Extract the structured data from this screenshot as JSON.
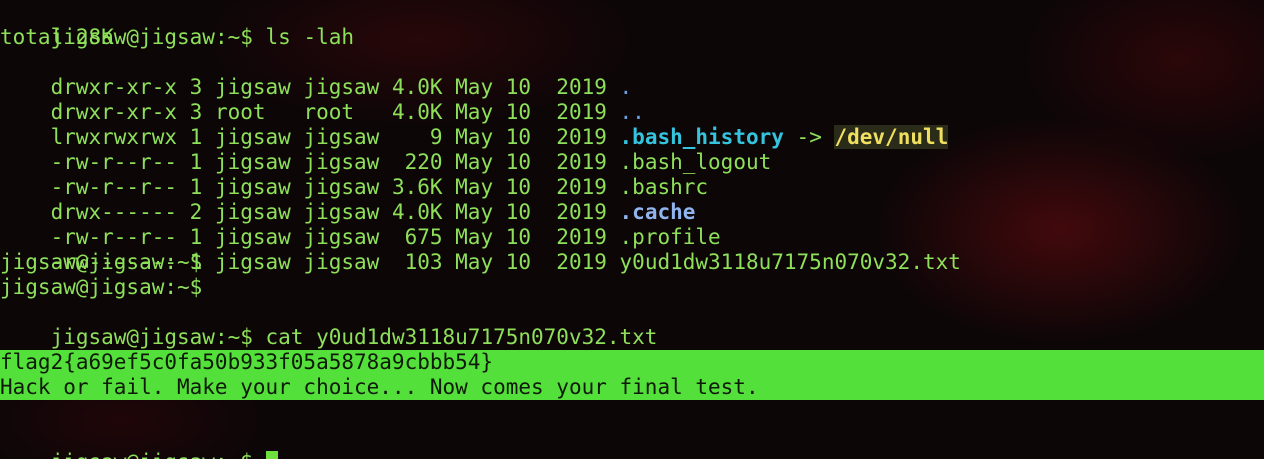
{
  "terminal": {
    "prompt": "jigsaw@jigsaw:~$",
    "command_ls": " ls -lah",
    "total": "total 28K",
    "entries": [
      {
        "meta": "drwxr-xr-x 3 jigsaw jigsaw 4.0K May 10  2019 ",
        "name": "."
      },
      {
        "meta": "drwxr-xr-x 3 root   root   4.0K May 10  2019 ",
        "name": ".."
      },
      {
        "meta": "lrwxrwxrwx 1 jigsaw jigsaw    9 May 10  2019 ",
        "name": ".bash_history",
        "arrow": " -> ",
        "target": "/dev/null"
      },
      {
        "meta": "-rw-r--r-- 1 jigsaw jigsaw  220 May 10  2019 ",
        "name": ".bash_logout"
      },
      {
        "meta": "-rw-r--r-- 1 jigsaw jigsaw 3.6K May 10  2019 ",
        "name": ".bashrc"
      },
      {
        "meta": "drwx------ 2 jigsaw jigsaw 4.0K May 10  2019 ",
        "name": ".cache"
      },
      {
        "meta": "-rw-r--r-- 1 jigsaw jigsaw  675 May 10  2019 ",
        "name": ".profile"
      },
      {
        "meta": "-rw------- 1 jigsaw jigsaw  103 May 10  2019 ",
        "name": "y0ud1dw3118u7175n070v32.txt"
      }
    ],
    "command_cat": " cat y0ud1dw3118u7175n070v32.txt",
    "flag_line": "flag2{a69ef5c0fa50b933f05a5878a9cbbb54}",
    "message_line": "Hack or fail. Make your choice... Now comes your final test.",
    "prompt_final": "jigsaw@jigsaw:~$ "
  },
  "colors": {
    "foreground": "#8ee05a",
    "highlight_band": "#54e03a",
    "directory": "#6a9fe0",
    "symlink": "#35c4dd",
    "link_target": "#f0e060"
  }
}
